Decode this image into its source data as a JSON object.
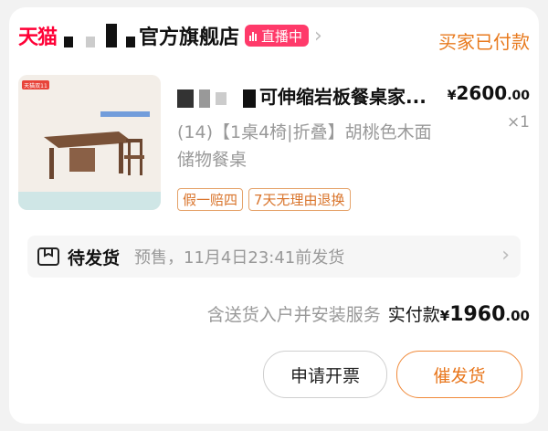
{
  "shop": {
    "platform_logo": "天猫",
    "name_suffix": "官方旗舰店",
    "live_badge": "直播中",
    "order_status": "买家已付款"
  },
  "product": {
    "title_suffix": "可伸缩岩板餐桌家...",
    "price_currency": "¥",
    "price_int": "2600",
    "price_dec": ".00",
    "sku": "(14)【1桌4椅|折叠】胡桃色木面储物餐桌",
    "quantity": "×1",
    "tags": [
      "假一赔四",
      "7天无理由退换"
    ],
    "thumbnail_label": "天猫双11"
  },
  "shipping": {
    "label": "待发货",
    "description": "预售，11月4日23:41前发货"
  },
  "summary": {
    "service": "含送货入户并安装服务",
    "paid_label": "实付款",
    "currency": "¥",
    "amount_int": "1960",
    "amount_dec": ".00"
  },
  "actions": {
    "invoice": "申请开票",
    "urge": "催发货"
  },
  "colors": {
    "tmall_red": "#ff0036",
    "live_pink": "#ff3a6a",
    "status_orange": "#e87a1e",
    "tag_orange": "#d9742b"
  }
}
